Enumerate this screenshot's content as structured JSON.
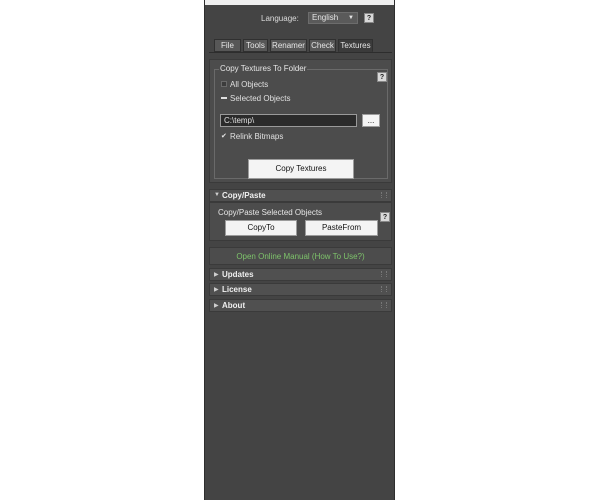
{
  "language": {
    "label": "Language:",
    "selected": "English",
    "help": "?"
  },
  "tabs": [
    {
      "label": "File"
    },
    {
      "label": "Tools"
    },
    {
      "label": "Renamer"
    },
    {
      "label": "Check"
    },
    {
      "label": "Textures"
    }
  ],
  "textures": {
    "group_title": "Copy Textures To Folder",
    "help": "?",
    "option_all": "All Objects",
    "option_selected": "Selected Objects",
    "path_value": "C:\\temp\\",
    "browse_label": "...",
    "relink_label": "Relink Bitmaps",
    "copy_button": "Copy Textures"
  },
  "copy_paste": {
    "title": "Copy/Paste",
    "group_title": "Copy/Paste Selected Objects",
    "help": "?",
    "copy_to": "CopyTo",
    "paste_from": "PasteFrom"
  },
  "manual_link": "Open Online Manual (How To Use?)",
  "rollouts": [
    {
      "title": "Updates"
    },
    {
      "title": "License"
    },
    {
      "title": "About"
    }
  ],
  "colors": {
    "panel_bg": "#444444",
    "link": "#7ec46b"
  }
}
